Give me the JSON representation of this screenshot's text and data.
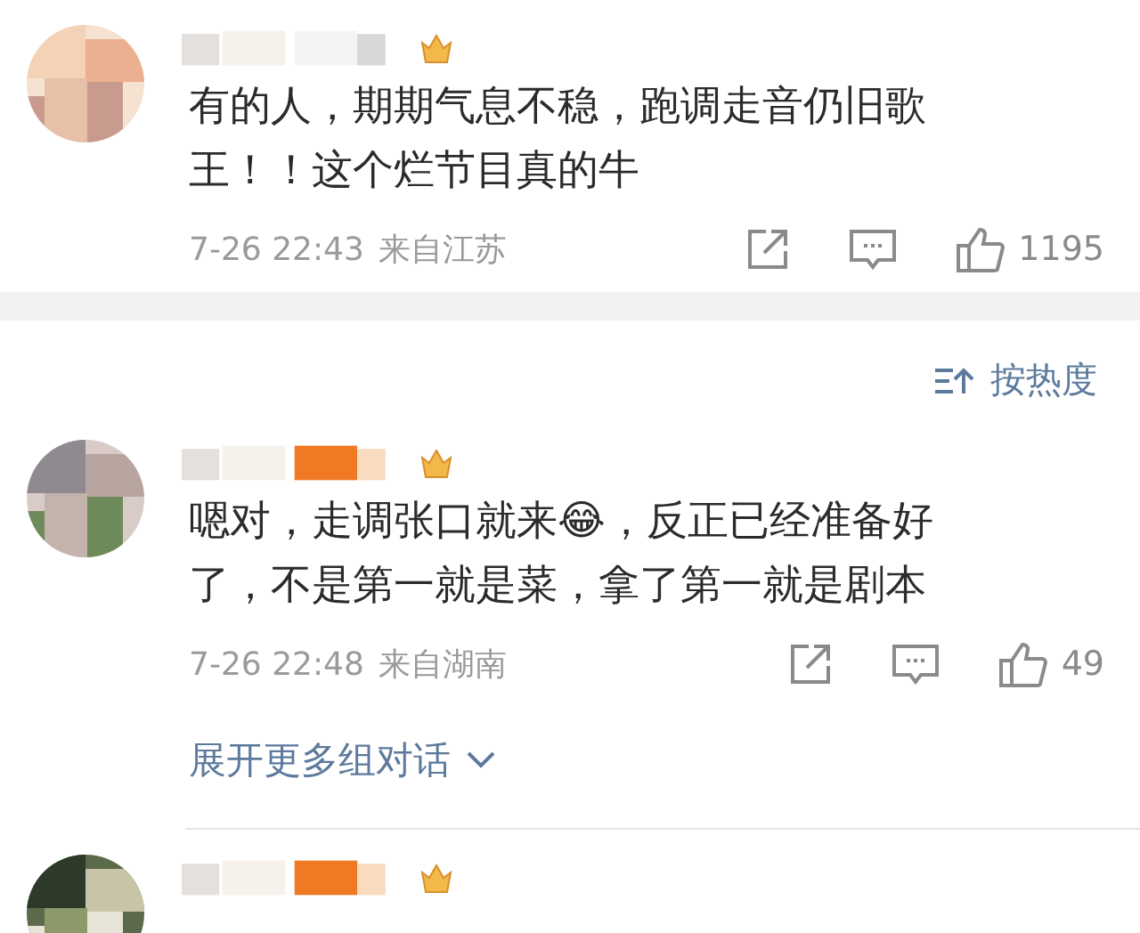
{
  "comments": [
    {
      "avatar": {
        "kind": "picture"
      },
      "text": "有的人，期期气息不稳，跑调走音仍旧歌王！！这个烂节目真的牛",
      "time": "7-26 22:43",
      "source": "来自江苏",
      "likes": "1195"
    },
    {
      "avatar": {
        "kind": "picture"
      },
      "text": "嗯对，走调张口就来😂，反正已经准备好了，不是第一就是菜，拿了第一就是剧本",
      "time": "7-26 22:48",
      "source": "来自湖南",
      "likes": "49",
      "more_replies": "展开更多组对话"
    },
    {
      "avatar": {
        "kind": "picture"
      }
    }
  ],
  "sort": {
    "label": "按热度"
  }
}
